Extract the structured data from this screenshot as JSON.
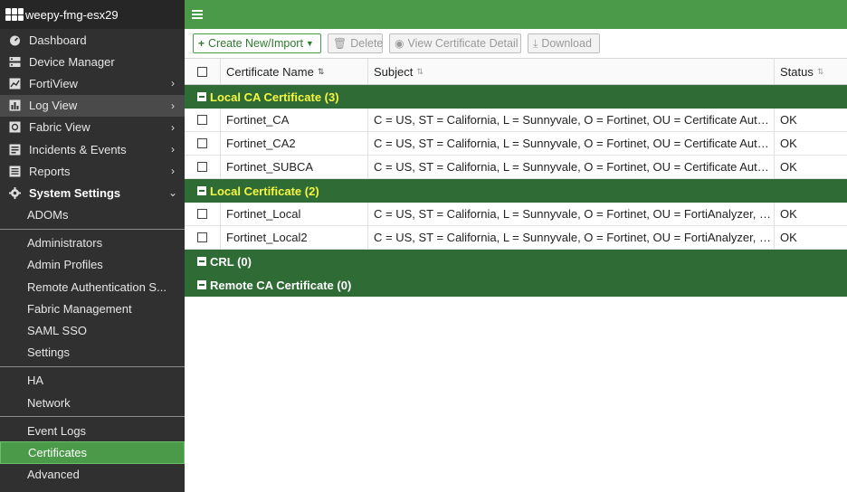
{
  "brand": {
    "name": "weepy-fmg-esx29"
  },
  "nav": [
    {
      "label": "Dashboard",
      "icon": "dashboard-icon",
      "chevron": false
    },
    {
      "label": "Device Manager",
      "icon": "device-manager-icon",
      "chevron": false
    },
    {
      "label": "FortiView",
      "icon": "fortiview-icon",
      "chevron": true
    },
    {
      "label": "Log View",
      "icon": "log-view-icon",
      "chevron": true
    },
    {
      "label": "Fabric View",
      "icon": "fabric-view-icon",
      "chevron": true
    },
    {
      "label": "Incidents & Events",
      "icon": "incidents-icon",
      "chevron": true
    },
    {
      "label": "Reports",
      "icon": "reports-icon",
      "chevron": true
    },
    {
      "label": "System Settings",
      "icon": "gear-icon",
      "chevron": true
    }
  ],
  "submenu": {
    "adoms": "ADOMs",
    "administrators": "Administrators",
    "admin_profiles": "Admin Profiles",
    "remote_auth": "Remote Authentication S...",
    "fabric_mgmt": "Fabric Management",
    "saml": "SAML SSO",
    "settings": "Settings",
    "ha": "HA",
    "network": "Network",
    "event_logs": "Event Logs",
    "certificates": "Certificates",
    "advanced": "Advanced"
  },
  "toolbar": {
    "create": "Create New/Import",
    "delete": "Delete",
    "view_detail": "View Certificate Detail",
    "download": "Download"
  },
  "table": {
    "headers": {
      "name": "Certificate Name",
      "subject": "Subject",
      "status": "Status"
    },
    "groups": {
      "local_ca": "Local CA Certificate (3)",
      "local": "Local Certificate (2)",
      "crl": "CRL (0)",
      "remote_ca": "Remote CA Certificate (0)"
    },
    "rows": [
      {
        "name": "Fortinet_CA",
        "subject": "C = US, ST = California, L = Sunnyvale, O = Fortinet, OU = Certificate Authority, ...",
        "status": "OK"
      },
      {
        "name": "Fortinet_CA2",
        "subject": "C = US, ST = California, L = Sunnyvale, O = Fortinet, OU = Certificate Authority, ...",
        "status": "OK"
      },
      {
        "name": "Fortinet_SUBCA",
        "subject": "C = US, ST = California, L = Sunnyvale, O = Fortinet, OU = Certificate Authority, ...",
        "status": "OK"
      },
      {
        "name": "Fortinet_Local",
        "subject": "C = US, ST = California, L = Sunnyvale, O = Fortinet, OU = FortiAnalyzer, CN = F...",
        "status": "OK"
      },
      {
        "name": "Fortinet_Local2",
        "subject": "C = US, ST = California, L = Sunnyvale, O = Fortinet, OU = FortiAnalyzer, CN = F...",
        "status": "OK"
      }
    ]
  },
  "colors": {
    "brand_green": "#4a9a4a",
    "group_green": "#2e6b35",
    "highlight": "#f7f742"
  }
}
